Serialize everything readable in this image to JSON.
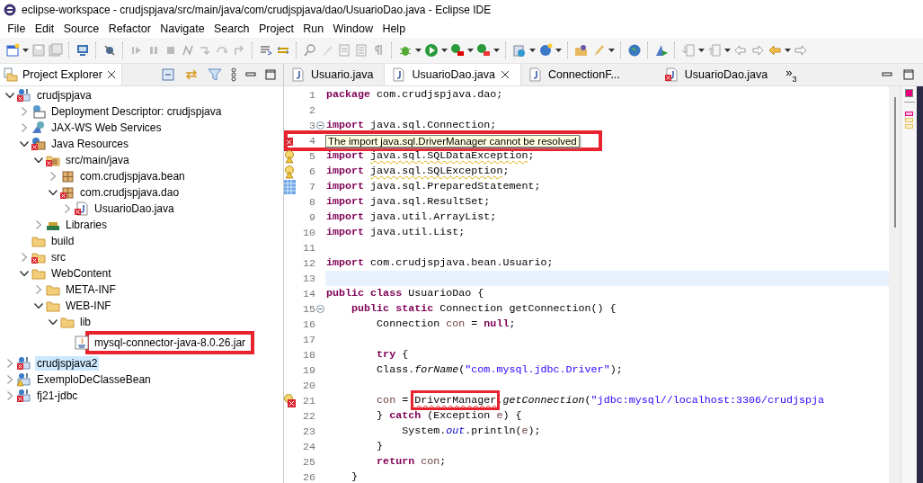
{
  "window": {
    "title": "eclipse-workspace - crudjspjava/src/main/java/com/crudjspjava/dao/UsuarioDao.java - Eclipse IDE"
  },
  "menu": [
    "File",
    "Edit",
    "Source",
    "Refactor",
    "Navigate",
    "Search",
    "Project",
    "Run",
    "Window",
    "Help"
  ],
  "project_explorer": {
    "title": "Project Explorer",
    "tree": [
      {
        "label": "crudjspjava",
        "kind": "project",
        "expandable": true,
        "expanded": true,
        "selected": false,
        "error": true,
        "warning": false,
        "highlighted": false,
        "children": [
          {
            "label": "Deployment Descriptor: crudjspjava",
            "kind": "descriptor",
            "expandable": true,
            "expanded": false,
            "selected": false,
            "error": false,
            "warning": false,
            "highlighted": false
          },
          {
            "label": "JAX-WS Web Services",
            "kind": "webservices",
            "expandable": true,
            "expanded": false,
            "selected": false,
            "error": false,
            "warning": false,
            "highlighted": false
          },
          {
            "label": "Java Resources",
            "kind": "resources",
            "expandable": true,
            "expanded": true,
            "selected": false,
            "error": true,
            "warning": false,
            "highlighted": false,
            "children": [
              {
                "label": "src/main/java",
                "kind": "srcfolder",
                "expandable": true,
                "expanded": true,
                "selected": false,
                "error": true,
                "warning": false,
                "highlighted": false,
                "children": [
                  {
                    "label": "com.crudjspjava.bean",
                    "kind": "package",
                    "expandable": true,
                    "expanded": false,
                    "selected": false,
                    "error": false,
                    "warning": false,
                    "highlighted": false
                  },
                  {
                    "label": "com.crudjspjava.dao",
                    "kind": "package",
                    "expandable": true,
                    "expanded": true,
                    "selected": false,
                    "error": true,
                    "warning": false,
                    "highlighted": false,
                    "children": [
                      {
                        "label": "UsuarioDao.java",
                        "kind": "javafile",
                        "expandable": true,
                        "expanded": false,
                        "selected": false,
                        "error": true,
                        "warning": false,
                        "highlighted": false
                      }
                    ]
                  }
                ]
              },
              {
                "label": "Libraries",
                "kind": "libraries",
                "expandable": true,
                "expanded": false,
                "selected": false,
                "error": false,
                "warning": false,
                "highlighted": false
              }
            ]
          },
          {
            "label": "build",
            "kind": "folder",
            "expandable": false,
            "selected": false,
            "error": false,
            "warning": false,
            "highlighted": false
          },
          {
            "label": "src",
            "kind": "folder",
            "expandable": true,
            "expanded": false,
            "selected": false,
            "error": true,
            "warning": false,
            "highlighted": false
          },
          {
            "label": "WebContent",
            "kind": "folder",
            "expandable": true,
            "expanded": true,
            "selected": false,
            "error": false,
            "warning": false,
            "highlighted": false,
            "children": [
              {
                "label": "META-INF",
                "kind": "folder",
                "expandable": true,
                "expanded": false,
                "selected": false,
                "error": false,
                "warning": false,
                "highlighted": false
              },
              {
                "label": "WEB-INF",
                "kind": "folder",
                "expandable": true,
                "expanded": true,
                "selected": false,
                "error": false,
                "warning": false,
                "highlighted": false,
                "children": [
                  {
                    "label": "lib",
                    "kind": "folder",
                    "expandable": true,
                    "expanded": true,
                    "selected": false,
                    "error": false,
                    "warning": false,
                    "highlighted": false,
                    "children": [
                      {
                        "label": "mysql-connector-java-8.0.26.jar",
                        "kind": "jar",
                        "expandable": false,
                        "selected": false,
                        "error": false,
                        "warning": false,
                        "highlighted": true
                      }
                    ]
                  }
                ]
              }
            ]
          }
        ]
      },
      {
        "label": "crudjspjava2",
        "kind": "project",
        "expandable": true,
        "expanded": false,
        "selected": true,
        "error": true,
        "warning": false,
        "highlighted": false
      },
      {
        "label": "ExemploDeClasseBean",
        "kind": "project",
        "expandable": true,
        "expanded": false,
        "selected": false,
        "error": false,
        "warning": true,
        "highlighted": false
      },
      {
        "label": "fj21-jdbc",
        "kind": "project",
        "expandable": true,
        "expanded": false,
        "selected": false,
        "error": true,
        "warning": false,
        "highlighted": false
      }
    ]
  },
  "editor": {
    "tabs": [
      {
        "label": "Usuario.java",
        "selected": false,
        "error": false
      },
      {
        "label": "UsuarioDao.java",
        "selected": true,
        "error": false
      },
      {
        "label": "ConnectionF...",
        "selected": false,
        "error": false
      },
      {
        "label": "UsuarioDao.java",
        "selected": false,
        "error": true
      }
    ],
    "overflow": {
      "symbol": "»",
      "count": "3"
    },
    "lines": [
      {
        "number": "1",
        "fold": false,
        "current": false,
        "tokens": [
          {
            "kind": "kw",
            "text": "package "
          },
          {
            "kind": "p",
            "text": "com.crudjspjava.dao;"
          }
        ]
      },
      {
        "number": "2",
        "fold": false,
        "current": false
      },
      {
        "number": "3",
        "fold": true,
        "current": false,
        "tokens": [
          {
            "kind": "kw",
            "text": "import "
          },
          {
            "kind": "p",
            "text": "java.sql.Connection;"
          }
        ]
      },
      {
        "number": "4",
        "marker": {
          "kind": "error"
        },
        "fold": false,
        "current": false,
        "tooltip": "The import java.sql.DriverManager cannot be resolved"
      },
      {
        "number": "5",
        "marker": {
          "kind": "warning"
        },
        "fold": false,
        "current": false,
        "tokens": [
          {
            "kind": "kw",
            "text": "import "
          },
          {
            "kind": "warn",
            "text": "java.sql.SQLDataException"
          },
          {
            "kind": "p",
            "text": ";"
          }
        ]
      },
      {
        "number": "6",
        "marker": {
          "kind": "warning"
        },
        "fold": false,
        "current": false,
        "tokens": [
          {
            "kind": "kw",
            "text": "import "
          },
          {
            "kind": "warn",
            "text": "java.sql.SQLException"
          },
          {
            "kind": "p",
            "text": ";"
          }
        ]
      },
      {
        "number": "7",
        "marker": {
          "kind": "task"
        },
        "fold": false,
        "current": false,
        "tokens": [
          {
            "kind": "kw",
            "text": "import "
          },
          {
            "kind": "p",
            "text": "java.sql.PreparedStatement;"
          }
        ]
      },
      {
        "number": "8",
        "fold": false,
        "current": false,
        "tokens": [
          {
            "kind": "kw",
            "text": "import "
          },
          {
            "kind": "p",
            "text": "java.sql.ResultSet;"
          }
        ]
      },
      {
        "number": "9",
        "fold": false,
        "current": false,
        "tokens": [
          {
            "kind": "kw",
            "text": "import "
          },
          {
            "kind": "p",
            "text": "java.util.ArrayList;"
          }
        ]
      },
      {
        "number": "10",
        "fold": false,
        "current": false,
        "tokens": [
          {
            "kind": "kw",
            "text": "import "
          },
          {
            "kind": "p",
            "text": "java.util.List;"
          }
        ]
      },
      {
        "number": "11",
        "fold": false,
        "current": false
      },
      {
        "number": "12",
        "fold": false,
        "current": false,
        "tokens": [
          {
            "kind": "kw",
            "text": "import "
          },
          {
            "kind": "p",
            "text": "com.crudjspjava.bean.Usuario;"
          }
        ]
      },
      {
        "number": "13",
        "fold": false,
        "current": true
      },
      {
        "number": "14",
        "fold": false,
        "current": false,
        "tokens": [
          {
            "kind": "kw",
            "text": "public class "
          },
          {
            "kind": "p",
            "text": "UsuarioDao {"
          }
        ]
      },
      {
        "number": "15",
        "fold": true,
        "current": false,
        "tokens": [
          {
            "kind": "kw",
            "text": "    public static "
          },
          {
            "kind": "p",
            "text": "Connection getConnection() {"
          }
        ]
      },
      {
        "number": "16",
        "fold": false,
        "current": false,
        "tokens": [
          {
            "kind": "p",
            "text": "        Connection "
          },
          {
            "kind": "local",
            "text": "con"
          },
          {
            "kind": "p",
            "text": " = "
          },
          {
            "kind": "kw",
            "text": "null"
          },
          {
            "kind": "p",
            "text": ";"
          }
        ]
      },
      {
        "number": "17",
        "fold": false,
        "current": false
      },
      {
        "number": "18",
        "fold": false,
        "current": false,
        "tokens": [
          {
            "kind": "kw",
            "text": "        try"
          },
          {
            "kind": "p",
            "text": " {"
          }
        ]
      },
      {
        "number": "19",
        "fold": false,
        "current": false,
        "tokens": [
          {
            "kind": "p",
            "text": "        Class."
          },
          {
            "kind": "static",
            "text": "forName"
          },
          {
            "kind": "p",
            "text": "("
          },
          {
            "kind": "str",
            "text": "\"com.mysql.jdbc.Driver\""
          },
          {
            "kind": "p",
            "text": ");"
          }
        ]
      },
      {
        "number": "20",
        "fold": false,
        "current": false
      },
      {
        "number": "21",
        "marker": {
          "kind": "error-warning"
        },
        "fold": false,
        "current": false,
        "tokens": [
          {
            "kind": "local",
            "text": "        con"
          },
          {
            "kind": "p",
            "text": " = "
          },
          {
            "kind": "err-boxed",
            "text": "DriverManager"
          },
          {
            "kind": "p",
            "text": "."
          },
          {
            "kind": "static",
            "text": "getConnection"
          },
          {
            "kind": "p",
            "text": "("
          },
          {
            "kind": "str",
            "text": "\"jdbc:mysql//localhost:3306/crudjspja"
          }
        ]
      },
      {
        "number": "22",
        "fold": false,
        "current": false,
        "tokens": [
          {
            "kind": "p",
            "text": "        } "
          },
          {
            "kind": "kw",
            "text": "catch"
          },
          {
            "kind": "p",
            "text": " (Exception "
          },
          {
            "kind": "local",
            "text": "e"
          },
          {
            "kind": "p",
            "text": ") {"
          }
        ]
      },
      {
        "number": "23",
        "fold": false,
        "current": false,
        "tokens": [
          {
            "kind": "p",
            "text": "            System."
          },
          {
            "kind": "field",
            "text": "out"
          },
          {
            "kind": "p",
            "text": ".println("
          },
          {
            "kind": "local",
            "text": "e"
          },
          {
            "kind": "p",
            "text": ");"
          }
        ]
      },
      {
        "number": "24",
        "fold": false,
        "current": false,
        "tokens": [
          {
            "kind": "p",
            "text": "        }"
          }
        ]
      },
      {
        "number": "25",
        "fold": false,
        "current": false,
        "tokens": [
          {
            "kind": "kw",
            "text": "        return "
          },
          {
            "kind": "local",
            "text": "con"
          },
          {
            "kind": "p",
            "text": ";"
          }
        ]
      },
      {
        "number": "26",
        "fold": false,
        "current": false,
        "tokens": [
          {
            "kind": "p",
            "text": "    }"
          }
        ]
      }
    ]
  }
}
